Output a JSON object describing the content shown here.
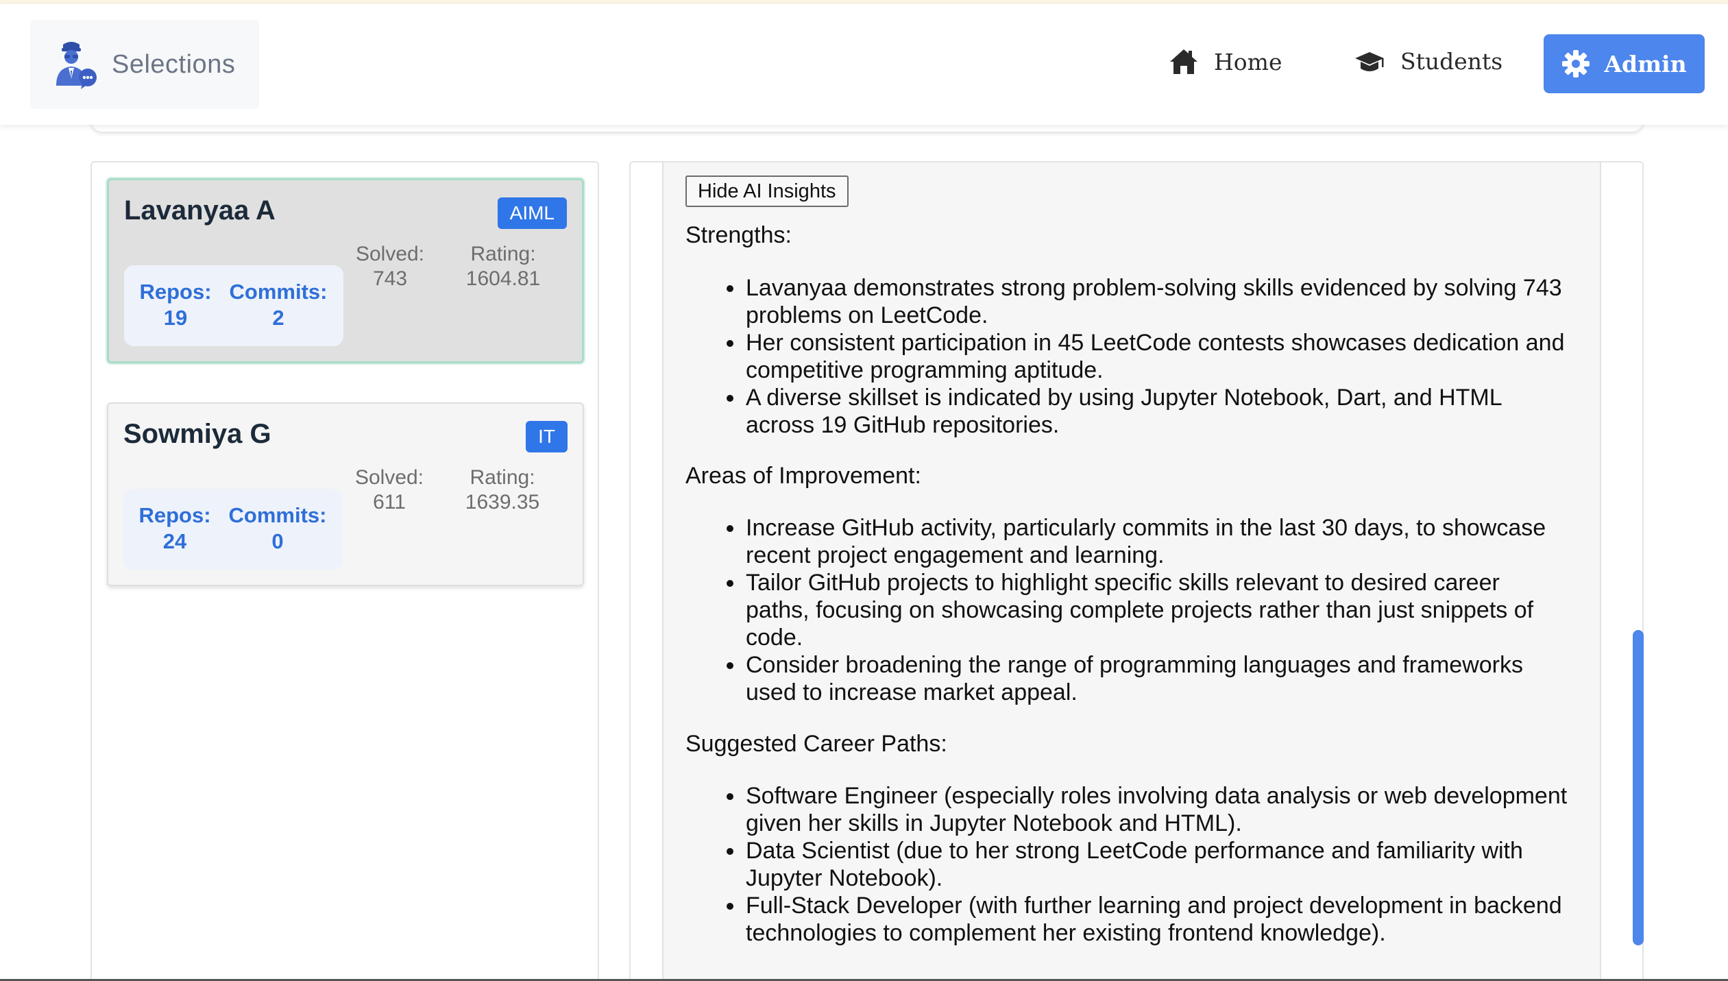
{
  "header": {
    "app_name": "Selections",
    "nav": {
      "home": "Home",
      "students": "Students",
      "admin": "Admin"
    },
    "accent_color": "#4d86ec"
  },
  "students": [
    {
      "name": "Lavanyaa A",
      "dept": "AIML",
      "repos_label": "Repos:",
      "repos": "19",
      "commits_label": "Commits:",
      "commits": "2",
      "solved_label": "Solved:",
      "solved": "743",
      "rating_label": "Rating:",
      "rating": "1604.81",
      "selected": true
    },
    {
      "name": "Sowmiya G",
      "dept": "IT",
      "repos_label": "Repos:",
      "repos": "24",
      "commits_label": "Commits:",
      "commits": "0",
      "solved_label": "Solved:",
      "solved": "611",
      "rating_label": "Rating:",
      "rating": "1639.35",
      "selected": false
    }
  ],
  "insights": {
    "toggle_label": "Hide AI Insights",
    "strengths_title": "Strengths:",
    "strengths": [
      "Lavanyaa demonstrates strong problem-solving skills evidenced by solving 743 problems on LeetCode.",
      "Her consistent participation in 45 LeetCode contests showcases dedication and competitive programming aptitude.",
      "A diverse skillset is indicated by using Jupyter Notebook, Dart, and HTML across 19 GitHub repositories."
    ],
    "improvement_title": "Areas of Improvement:",
    "improvements": [
      "Increase GitHub activity, particularly commits in the last 30 days, to showcase recent project engagement and learning.",
      "Tailor GitHub projects to highlight specific skills relevant to desired career paths, focusing on showcasing complete projects rather than just snippets of code.",
      "Consider broadening the range of programming languages and frameworks used to increase market appeal."
    ],
    "careers_title": "Suggested Career Paths:",
    "careers": [
      "Software Engineer (especially roles involving data analysis or web development given her skills in Jupyter Notebook and HTML).",
      "Data Scientist (due to her strong LeetCode performance and familiarity with Jupyter Notebook).",
      "Full-Stack Developer (with further learning and project development in backend technologies to complement her existing frontend knowledge)."
    ]
  }
}
